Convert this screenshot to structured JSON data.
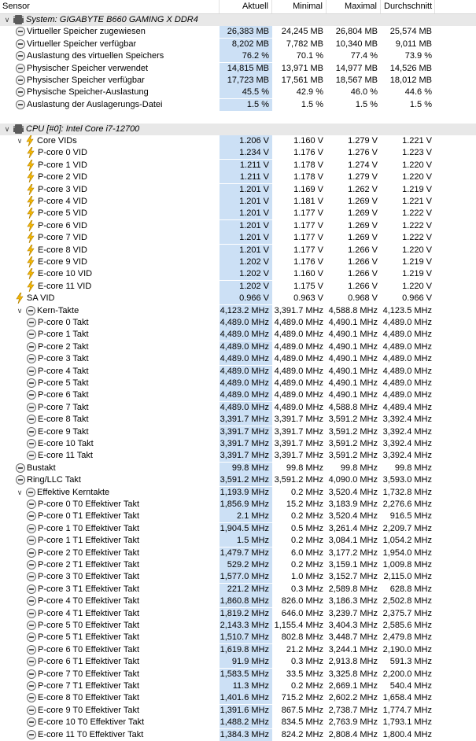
{
  "header": {
    "sensor": "Sensor",
    "current": "Aktuell",
    "min": "Minimal",
    "max": "Maximal",
    "avg": "Durchschnitt"
  },
  "rows": [
    {
      "type": "group",
      "level": 0,
      "icon": "chip-icon",
      "label": "System: GIGABYTE B660 GAMING X DDR4",
      "expanded": true
    },
    {
      "level": 1,
      "icon": "clock-icon",
      "label": "Virtueller Speicher zugewiesen",
      "cur": "26,383 MB",
      "min": "24,245 MB",
      "max": "26,804 MB",
      "avg": "25,574 MB"
    },
    {
      "level": 1,
      "icon": "clock-icon",
      "label": "Virtueller Speicher verfügbar",
      "cur": "8,202 MB",
      "min": "7,782 MB",
      "max": "10,340 MB",
      "avg": "9,011 MB"
    },
    {
      "level": 1,
      "icon": "clock-icon",
      "label": "Auslastung des virtuellen Speichers",
      "cur": "76.2 %",
      "min": "70.1 %",
      "max": "77.4 %",
      "avg": "73.9 %"
    },
    {
      "level": 1,
      "icon": "clock-icon",
      "label": "Physischer Speicher verwendet",
      "cur": "14,815 MB",
      "min": "13,971 MB",
      "max": "14,977 MB",
      "avg": "14,526 MB"
    },
    {
      "level": 1,
      "icon": "clock-icon",
      "label": "Physischer Speicher verfügbar",
      "cur": "17,723 MB",
      "min": "17,561 MB",
      "max": "18,567 MB",
      "avg": "18,012 MB"
    },
    {
      "level": 1,
      "icon": "clock-icon",
      "label": "Physische Speicher-Auslastung",
      "cur": "45.5 %",
      "min": "42.9 %",
      "max": "46.0 %",
      "avg": "44.6 %"
    },
    {
      "level": 1,
      "icon": "clock-icon",
      "label": "Auslastung der Auslagerungs-Datei",
      "cur": "1.5 %",
      "min": "1.5 %",
      "max": "1.5 %",
      "avg": "1.5 %"
    },
    {
      "type": "blank"
    },
    {
      "type": "group",
      "level": 0,
      "icon": "chip-icon",
      "label": "CPU [#0]: Intel Core i7-12700",
      "expanded": true
    },
    {
      "level": 1,
      "icon": "bolt-icon",
      "label": "Core VIDs",
      "expander": true,
      "cur": "1.206 V",
      "min": "1.160 V",
      "max": "1.279 V",
      "avg": "1.221 V"
    },
    {
      "level": 2,
      "icon": "bolt-icon",
      "label": "P-core 0 VID",
      "cur": "1.234 V",
      "min": "1.176 V",
      "max": "1.276 V",
      "avg": "1.223 V"
    },
    {
      "level": 2,
      "icon": "bolt-icon",
      "label": "P-core 1 VID",
      "cur": "1.211 V",
      "min": "1.178 V",
      "max": "1.274 V",
      "avg": "1.220 V"
    },
    {
      "level": 2,
      "icon": "bolt-icon",
      "label": "P-core 2 VID",
      "cur": "1.211 V",
      "min": "1.178 V",
      "max": "1.279 V",
      "avg": "1.220 V"
    },
    {
      "level": 2,
      "icon": "bolt-icon",
      "label": "P-core 3 VID",
      "cur": "1.201 V",
      "min": "1.169 V",
      "max": "1.262 V",
      "avg": "1.219 V"
    },
    {
      "level": 2,
      "icon": "bolt-icon",
      "label": "P-core 4 VID",
      "cur": "1.201 V",
      "min": "1.181 V",
      "max": "1.269 V",
      "avg": "1.221 V"
    },
    {
      "level": 2,
      "icon": "bolt-icon",
      "label": "P-core 5 VID",
      "cur": "1.201 V",
      "min": "1.177 V",
      "max": "1.269 V",
      "avg": "1.222 V"
    },
    {
      "level": 2,
      "icon": "bolt-icon",
      "label": "P-core 6 VID",
      "cur": "1.201 V",
      "min": "1.177 V",
      "max": "1.269 V",
      "avg": "1.222 V"
    },
    {
      "level": 2,
      "icon": "bolt-icon",
      "label": "P-core 7 VID",
      "cur": "1.201 V",
      "min": "1.177 V",
      "max": "1.269 V",
      "avg": "1.222 V"
    },
    {
      "level": 2,
      "icon": "bolt-icon",
      "label": "E-core 8 VID",
      "cur": "1.201 V",
      "min": "1.177 V",
      "max": "1.266 V",
      "avg": "1.220 V"
    },
    {
      "level": 2,
      "icon": "bolt-icon",
      "label": "E-core 9 VID",
      "cur": "1.202 V",
      "min": "1.176 V",
      "max": "1.266 V",
      "avg": "1.219 V"
    },
    {
      "level": 2,
      "icon": "bolt-icon",
      "label": "E-core 10 VID",
      "cur": "1.202 V",
      "min": "1.160 V",
      "max": "1.266 V",
      "avg": "1.219 V"
    },
    {
      "level": 2,
      "icon": "bolt-icon",
      "label": "E-core 11 VID",
      "cur": "1.202 V",
      "min": "1.175 V",
      "max": "1.266 V",
      "avg": "1.220 V"
    },
    {
      "level": 1,
      "icon": "bolt-icon",
      "label": "SA VID",
      "cur": "0.966 V",
      "min": "0.963 V",
      "max": "0.968 V",
      "avg": "0.966 V"
    },
    {
      "level": 1,
      "icon": "clock-icon",
      "label": "Kern-Takte",
      "expander": true,
      "cur": "4,123.2 MHz",
      "min": "3,391.7 MHz",
      "max": "4,588.8 MHz",
      "avg": "4,123.5 MHz"
    },
    {
      "level": 2,
      "icon": "clock-icon",
      "label": "P-core 0 Takt",
      "cur": "4,489.0 MHz",
      "min": "4,489.0 MHz",
      "max": "4,490.1 MHz",
      "avg": "4,489.0 MHz"
    },
    {
      "level": 2,
      "icon": "clock-icon",
      "label": "P-core 1 Takt",
      "cur": "4,489.0 MHz",
      "min": "4,489.0 MHz",
      "max": "4,490.1 MHz",
      "avg": "4,489.0 MHz"
    },
    {
      "level": 2,
      "icon": "clock-icon",
      "label": "P-core 2 Takt",
      "cur": "4,489.0 MHz",
      "min": "4,489.0 MHz",
      "max": "4,490.1 MHz",
      "avg": "4,489.0 MHz"
    },
    {
      "level": 2,
      "icon": "clock-icon",
      "label": "P-core 3 Takt",
      "cur": "4,489.0 MHz",
      "min": "4,489.0 MHz",
      "max": "4,490.1 MHz",
      "avg": "4,489.0 MHz"
    },
    {
      "level": 2,
      "icon": "clock-icon",
      "label": "P-core 4 Takt",
      "cur": "4,489.0 MHz",
      "min": "4,489.0 MHz",
      "max": "4,490.1 MHz",
      "avg": "4,489.0 MHz"
    },
    {
      "level": 2,
      "icon": "clock-icon",
      "label": "P-core 5 Takt",
      "cur": "4,489.0 MHz",
      "min": "4,489.0 MHz",
      "max": "4,490.1 MHz",
      "avg": "4,489.0 MHz"
    },
    {
      "level": 2,
      "icon": "clock-icon",
      "label": "P-core 6 Takt",
      "cur": "4,489.0 MHz",
      "min": "4,489.0 MHz",
      "max": "4,490.1 MHz",
      "avg": "4,489.0 MHz"
    },
    {
      "level": 2,
      "icon": "clock-icon",
      "label": "P-core 7 Takt",
      "cur": "4,489.0 MHz",
      "min": "4,489.0 MHz",
      "max": "4,588.8 MHz",
      "avg": "4,489.4 MHz"
    },
    {
      "level": 2,
      "icon": "clock-icon",
      "label": "E-core 8 Takt",
      "cur": "3,391.7 MHz",
      "min": "3,391.7 MHz",
      "max": "3,591.2 MHz",
      "avg": "3,392.4 MHz"
    },
    {
      "level": 2,
      "icon": "clock-icon",
      "label": "E-core 9 Takt",
      "cur": "3,391.7 MHz",
      "min": "3,391.7 MHz",
      "max": "3,591.2 MHz",
      "avg": "3,392.4 MHz"
    },
    {
      "level": 2,
      "icon": "clock-icon",
      "label": "E-core 10 Takt",
      "cur": "3,391.7 MHz",
      "min": "3,391.7 MHz",
      "max": "3,591.2 MHz",
      "avg": "3,392.4 MHz"
    },
    {
      "level": 2,
      "icon": "clock-icon",
      "label": "E-core 11 Takt",
      "cur": "3,391.7 MHz",
      "min": "3,391.7 MHz",
      "max": "3,591.2 MHz",
      "avg": "3,392.4 MHz"
    },
    {
      "level": 1,
      "icon": "clock-icon",
      "label": "Bustakt",
      "cur": "99.8 MHz",
      "min": "99.8 MHz",
      "max": "99.8 MHz",
      "avg": "99.8 MHz"
    },
    {
      "level": 1,
      "icon": "clock-icon",
      "label": "Ring/LLC Takt",
      "cur": "3,591.2 MHz",
      "min": "3,591.2 MHz",
      "max": "4,090.0 MHz",
      "avg": "3,593.0 MHz"
    },
    {
      "level": 1,
      "icon": "clock-icon",
      "label": "Effektive Kerntakte",
      "expander": true,
      "cur": "1,193.9 MHz",
      "min": "0.2 MHz",
      "max": "3,520.4 MHz",
      "avg": "1,732.8 MHz"
    },
    {
      "level": 2,
      "icon": "clock-icon",
      "label": "P-core 0 T0 Effektiver Takt",
      "cur": "1,856.9 MHz",
      "min": "15.2 MHz",
      "max": "3,183.9 MHz",
      "avg": "2,276.6 MHz"
    },
    {
      "level": 2,
      "icon": "clock-icon",
      "label": "P-core 0 T1 Effektiver Takt",
      "cur": "2.1 MHz",
      "min": "0.2 MHz",
      "max": "3,520.4 MHz",
      "avg": "916.5 MHz"
    },
    {
      "level": 2,
      "icon": "clock-icon",
      "label": "P-core 1 T0 Effektiver Takt",
      "cur": "1,904.5 MHz",
      "min": "0.5 MHz",
      "max": "3,261.4 MHz",
      "avg": "2,209.7 MHz"
    },
    {
      "level": 2,
      "icon": "clock-icon",
      "label": "P-core 1 T1 Effektiver Takt",
      "cur": "1.5 MHz",
      "min": "0.2 MHz",
      "max": "3,084.1 MHz",
      "avg": "1,054.2 MHz"
    },
    {
      "level": 2,
      "icon": "clock-icon",
      "label": "P-core 2 T0 Effektiver Takt",
      "cur": "1,479.7 MHz",
      "min": "6.0 MHz",
      "max": "3,177.2 MHz",
      "avg": "1,954.0 MHz"
    },
    {
      "level": 2,
      "icon": "clock-icon",
      "label": "P-core 2 T1 Effektiver Takt",
      "cur": "529.2 MHz",
      "min": "0.2 MHz",
      "max": "3,159.1 MHz",
      "avg": "1,009.8 MHz"
    },
    {
      "level": 2,
      "icon": "clock-icon",
      "label": "P-core 3 T0 Effektiver Takt",
      "cur": "1,577.0 MHz",
      "min": "1.0 MHz",
      "max": "3,152.7 MHz",
      "avg": "2,115.0 MHz"
    },
    {
      "level": 2,
      "icon": "clock-icon",
      "label": "P-core 3 T1 Effektiver Takt",
      "cur": "221.2 MHz",
      "min": "0.3 MHz",
      "max": "2,589.8 MHz",
      "avg": "628.8 MHz"
    },
    {
      "level": 2,
      "icon": "clock-icon",
      "label": "P-core 4 T0 Effektiver Takt",
      "cur": "1,860.8 MHz",
      "min": "826.0 MHz",
      "max": "3,186.3 MHz",
      "avg": "2,502.8 MHz"
    },
    {
      "level": 2,
      "icon": "clock-icon",
      "label": "P-core 4 T1 Effektiver Takt",
      "cur": "1,819.2 MHz",
      "min": "646.0 MHz",
      "max": "3,239.7 MHz",
      "avg": "2,375.7 MHz"
    },
    {
      "level": 2,
      "icon": "clock-icon",
      "label": "P-core 5 T0 Effektiver Takt",
      "cur": "2,143.3 MHz",
      "min": "1,155.4 MHz",
      "max": "3,404.3 MHz",
      "avg": "2,585.6 MHz"
    },
    {
      "level": 2,
      "icon": "clock-icon",
      "label": "P-core 5 T1 Effektiver Takt",
      "cur": "1,510.7 MHz",
      "min": "802.8 MHz",
      "max": "3,448.7 MHz",
      "avg": "2,479.8 MHz"
    },
    {
      "level": 2,
      "icon": "clock-icon",
      "label": "P-core 6 T0 Effektiver Takt",
      "cur": "1,619.8 MHz",
      "min": "21.2 MHz",
      "max": "3,244.1 MHz",
      "avg": "2,190.0 MHz"
    },
    {
      "level": 2,
      "icon": "clock-icon",
      "label": "P-core 6 T1 Effektiver Takt",
      "cur": "91.9 MHz",
      "min": "0.3 MHz",
      "max": "2,913.8 MHz",
      "avg": "591.3 MHz"
    },
    {
      "level": 2,
      "icon": "clock-icon",
      "label": "P-core 7 T0 Effektiver Takt",
      "cur": "1,583.5 MHz",
      "min": "33.5 MHz",
      "max": "3,325.8 MHz",
      "avg": "2,200.0 MHz"
    },
    {
      "level": 2,
      "icon": "clock-icon",
      "label": "P-core 7 T1 Effektiver Takt",
      "cur": "11.3 MHz",
      "min": "0.2 MHz",
      "max": "2,669.1 MHz",
      "avg": "540.4 MHz"
    },
    {
      "level": 2,
      "icon": "clock-icon",
      "label": "E-core 8 T0 Effektiver Takt",
      "cur": "1,401.6 MHz",
      "min": "715.2 MHz",
      "max": "2,602.2 MHz",
      "avg": "1,658.4 MHz"
    },
    {
      "level": 2,
      "icon": "clock-icon",
      "label": "E-core 9 T0 Effektiver Takt",
      "cur": "1,391.6 MHz",
      "min": "867.5 MHz",
      "max": "2,738.7 MHz",
      "avg": "1,774.7 MHz"
    },
    {
      "level": 2,
      "icon": "clock-icon",
      "label": "E-core 10 T0 Effektiver Takt",
      "cur": "1,488.2 MHz",
      "min": "834.5 MHz",
      "max": "2,763.9 MHz",
      "avg": "1,793.1 MHz"
    },
    {
      "level": 2,
      "icon": "clock-icon",
      "label": "E-core 11 T0 Effektiver Takt",
      "cur": "1,384.3 MHz",
      "min": "824.2 MHz",
      "max": "2,808.4 MHz",
      "avg": "1,800.4 MHz"
    }
  ]
}
